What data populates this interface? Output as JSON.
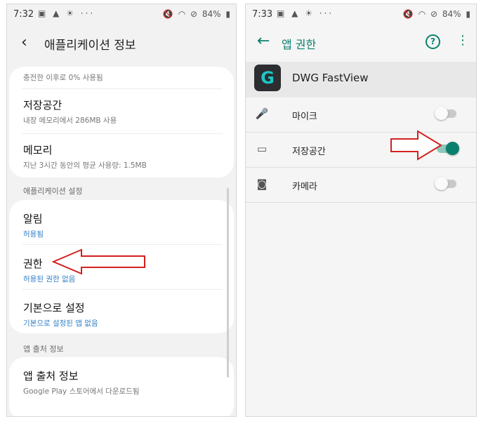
{
  "left_screen": {
    "status": {
      "time": "7:32",
      "battery": "84%"
    },
    "header": {
      "back_icon": "arrow-left-icon",
      "title": "애플리케이션 정보"
    },
    "card1": {
      "top_partial": "충전한 이후로 0% 사용됨",
      "storage": {
        "title": "저장공간",
        "subtitle": "내장 메모리에서 286MB 사용"
      },
      "memory": {
        "title": "메모리",
        "subtitle": "지난 3시간 동안의 평균 사용량: 1.5MB"
      }
    },
    "section_app_settings": "애플리케이션 설정",
    "card2": {
      "notifications": {
        "title": "알림",
        "subtitle": "허용됨"
      },
      "permissions": {
        "title": "권한",
        "subtitle": "허용된 권한 없음"
      },
      "defaults": {
        "title": "기본으로 설정",
        "subtitle": "기본으로 설정된 앱 없음"
      }
    },
    "section_app_source": "앱 출처 정보",
    "card3": {
      "source": {
        "title": "앱 출처 정보",
        "subtitle": "Google Play 스토어에서 다운로드됨"
      }
    }
  },
  "right_screen": {
    "status": {
      "time": "7:33",
      "battery": "84%"
    },
    "header": {
      "title": "앱 권한",
      "back_icon": "arrow-left-icon",
      "help_icon": "help-circle-icon",
      "more_icon": "more-vert-icon"
    },
    "app": {
      "name": "DWG FastView",
      "icon": "dwg-fastview-app-icon"
    },
    "permissions": [
      {
        "label": "마이크",
        "icon": "microphone-icon",
        "enabled": false
      },
      {
        "label": "저장공간",
        "icon": "folder-icon",
        "enabled": true
      },
      {
        "label": "카메라",
        "icon": "camera-icon",
        "enabled": false
      }
    ]
  },
  "colors": {
    "accent": "#0b7f6e",
    "link_blue": "#2f7ec7",
    "annotation_red": "#d42020"
  }
}
